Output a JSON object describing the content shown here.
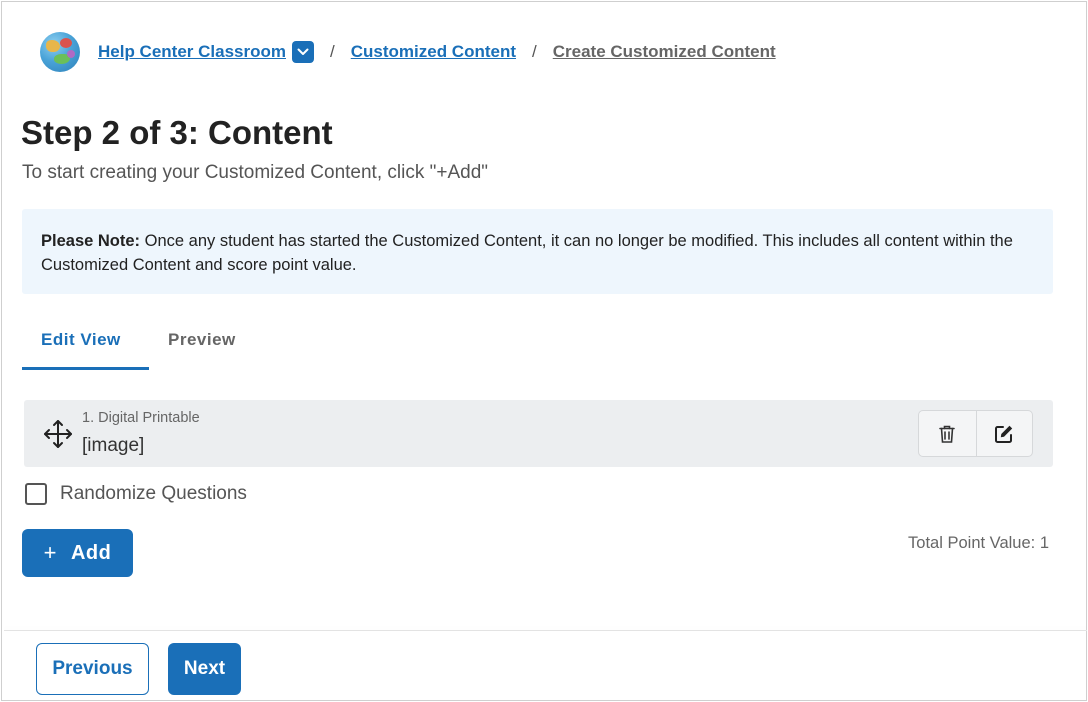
{
  "breadcrumb": {
    "classroom": "Help Center Classroom",
    "section": "Customized Content",
    "current": "Create Customized Content",
    "separator": "/"
  },
  "page": {
    "title": "Step 2 of 3: Content",
    "subtitle": "To start creating your Customized Content, click \"+Add\""
  },
  "note": {
    "label": "Please Note:",
    "text": " Once any student has started the Customized Content, it can no longer be modified. This includes all content within the Customized Content and score point value."
  },
  "tabs": [
    {
      "label": "Edit View",
      "active": true
    },
    {
      "label": "Preview",
      "active": false
    }
  ],
  "items": [
    {
      "label": "1. Digital Printable",
      "value": "[image]"
    }
  ],
  "randomize_label": "Randomize Questions",
  "add_button": {
    "icon": "+",
    "label": "Add"
  },
  "total_point_value": "Total Point Value: 1",
  "footer": {
    "previous_label": "Previous",
    "next_label": "Next"
  },
  "colors": {
    "accent": "#1a6fb8",
    "note_bg": "#eef6fd",
    "item_bg": "#eceef0"
  },
  "icons": [
    "globe-avatar-icon",
    "chevron-down-icon",
    "move-arrows-icon",
    "trash-icon",
    "edit-icon",
    "plus-icon"
  ]
}
